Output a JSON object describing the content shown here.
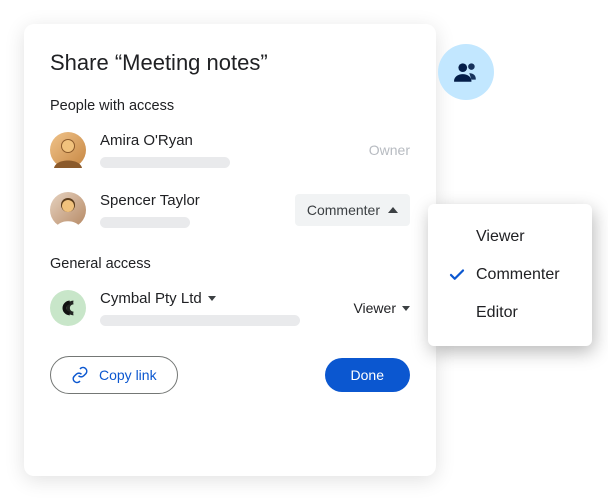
{
  "dialog": {
    "title": "Share “Meeting notes”",
    "people_section_label": "People with access",
    "general_section_label": "General access",
    "people": [
      {
        "name": "Amira O'Ryan",
        "role": "Owner",
        "role_kind": "static"
      },
      {
        "name": "Spencer Taylor",
        "role": "Commenter",
        "role_kind": "dropdown-open"
      }
    ],
    "general": {
      "org_name": "Cymbal Pty Ltd",
      "role": "Viewer"
    },
    "copy_link_label": "Copy link",
    "done_label": "Done"
  },
  "role_menu": {
    "items": [
      "Viewer",
      "Commenter",
      "Editor"
    ],
    "selected": "Commenter"
  },
  "icons": {
    "people": "people-icon",
    "link": "link-icon",
    "check": "check-icon",
    "dropdown": "chevron-down-icon",
    "dropdown_up": "chevron-up-icon",
    "cymbal_logo": "cymbal-logo"
  },
  "colors": {
    "primary": "#0b57d0",
    "badge_bg": "#c2e7ff",
    "chip_bg": "#f1f3f4",
    "muted": "#b7bbc1"
  }
}
